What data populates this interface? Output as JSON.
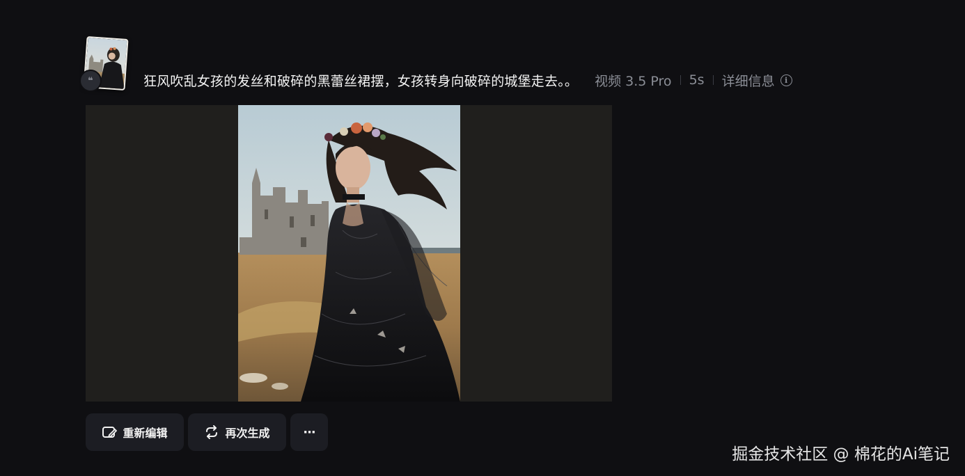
{
  "prompt": {
    "text": "狂风吹乱女孩的发丝和破碎的黑蕾丝裙摆，女孩转身向破碎的城堡走去。。",
    "model": "视频 3.5 Pro",
    "duration": "5s",
    "details_label": "详细信息"
  },
  "reference_thumbnail": {
    "icon": "quote-icon",
    "quote_glyph": "❝"
  },
  "actions": {
    "edit_label": "重新编辑",
    "regenerate_label": "再次生成",
    "more_glyph": "···"
  },
  "watermark": "掘金技术社区 @ 棉花的Ai笔记",
  "colors": {
    "background": "#0f0f12",
    "button_bg": "#1c1d23",
    "media_bg": "#201f1d",
    "meta_text": "#8b8e96"
  }
}
